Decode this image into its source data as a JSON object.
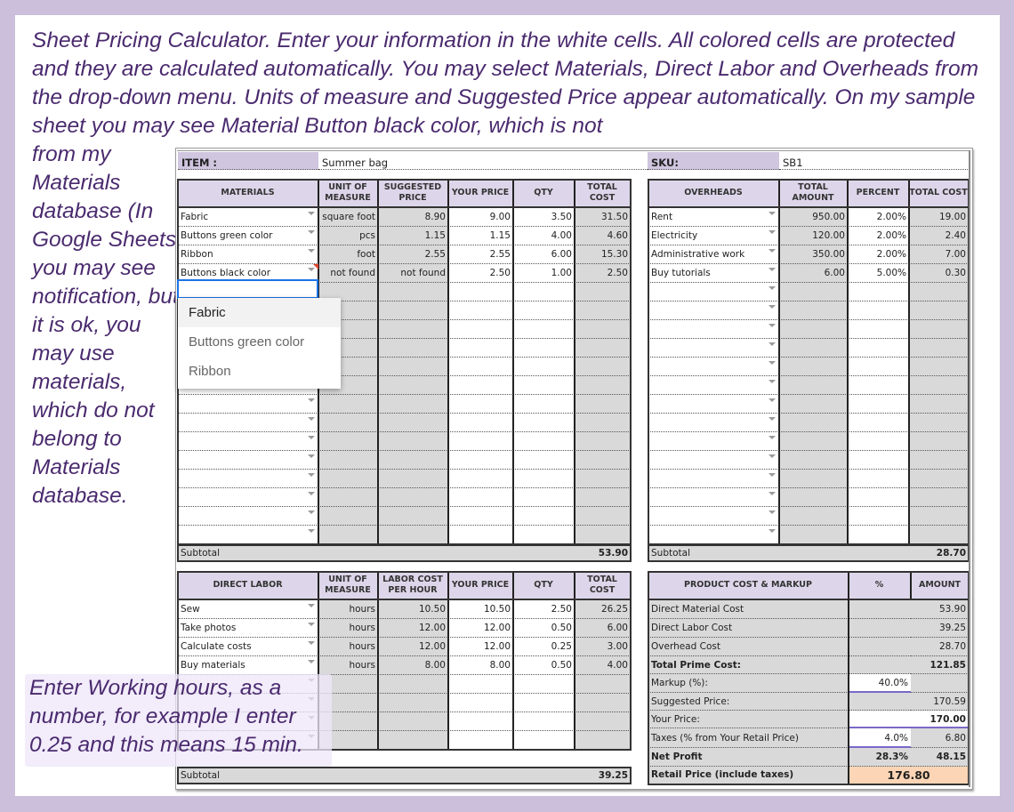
{
  "intro_text": "Sheet Pricing Calculator. Enter your information in the white cells. All colored cells are protected and they are calculated automatically. You may select Materials, Direct Labor and Overheads from the drop-down menu. Units of measure and Suggested Price appear automatically. On my sample sheet you may see Material Button black color, which is not",
  "side_text": "from my Materials database (In Google Sheets you may see notification, but it is ok, you may use materials, which do not belong to Materials database.",
  "note_text": "Enter Working hours, as a number, for example I enter 0.25 and this means 15 min.",
  "colors": {
    "background": "#cbbfdc",
    "header_fill": "#ddd6ea",
    "protected_fill": "#d9d9d9",
    "text_purple": "#4a2a6e",
    "retail_fill": "#fbd5b5",
    "selection_blue": "#1a73e8"
  },
  "item": {
    "label": "ITEM :",
    "value": "Summer bag"
  },
  "sku": {
    "label": "SKU:",
    "value": "SB1"
  },
  "materials": {
    "headers": [
      "MATERIALS",
      "UNIT OF MEASURE",
      "SUGGESTED PRICE",
      "YOUR PRICE",
      "QTY",
      "TOTAL COST"
    ],
    "rows": [
      {
        "name": "Fabric",
        "unit": "square foot",
        "suggested": "8.90",
        "price": "9.00",
        "qty": "3.50",
        "total": "31.50"
      },
      {
        "name": "Buttons green color",
        "unit": "pcs",
        "suggested": "1.15",
        "price": "1.15",
        "qty": "4.00",
        "total": "4.60"
      },
      {
        "name": "Ribbon",
        "unit": "foot",
        "suggested": "2.55",
        "price": "2.55",
        "qty": "6.00",
        "total": "15.30"
      },
      {
        "name": "Buttons black color",
        "unit": "not found",
        "suggested": "not found",
        "price": "2.50",
        "qty": "1.00",
        "total": "2.50"
      }
    ],
    "empty_rows": 14,
    "subtotal_label": "Subtotal",
    "subtotal": "53.90"
  },
  "dropdown": {
    "options": [
      "Fabric",
      "Buttons green color",
      "Ribbon"
    ],
    "highlighted": "Fabric"
  },
  "overheads": {
    "headers": [
      "OVERHEADS",
      "TOTAL AMOUNT",
      "PERCENT",
      "TOTAL COST"
    ],
    "rows": [
      {
        "name": "Rent",
        "amount": "950.00",
        "percent": "2.00%",
        "total": "19.00"
      },
      {
        "name": "Electricity",
        "amount": "120.00",
        "percent": "2.00%",
        "total": "2.40"
      },
      {
        "name": "Administrative work",
        "amount": "350.00",
        "percent": "2.00%",
        "total": "7.00"
      },
      {
        "name": "Buy tutorials",
        "amount": "6.00",
        "percent": "5.00%",
        "total": "0.30"
      }
    ],
    "empty_rows": 14,
    "subtotal_label": "Subtotal",
    "subtotal": "28.70"
  },
  "labor": {
    "headers": [
      "DIRECT LABOR",
      "UNIT OF MEASURE",
      "LABOR COST PER HOUR",
      "YOUR PRICE",
      "QTY",
      "TOTAL COST"
    ],
    "rows": [
      {
        "name": "Sew",
        "unit": "hours",
        "rate": "10.50",
        "price": "10.50",
        "qty": "2.50",
        "total": "26.25"
      },
      {
        "name": "Take photos",
        "unit": "hours",
        "rate": "12.00",
        "price": "12.00",
        "qty": "0.50",
        "total": "6.00"
      },
      {
        "name": "Calculate costs",
        "unit": "hours",
        "rate": "12.00",
        "price": "12.00",
        "qty": "0.25",
        "total": "3.00"
      },
      {
        "name": "Buy materials",
        "unit": "hours",
        "rate": "8.00",
        "price": "8.00",
        "qty": "0.50",
        "total": "4.00"
      }
    ],
    "empty_rows": 4,
    "subtotal_label": "Subtotal",
    "subtotal": "39.25"
  },
  "product_cost": {
    "headers": [
      "PRODUCT COST & MARKUP",
      "%",
      "AMOUNT"
    ],
    "rows": [
      {
        "label": "Direct Material Cost",
        "pct": "",
        "amount": "53.90",
        "bold": false
      },
      {
        "label": "Direct Labor Cost",
        "pct": "",
        "amount": "39.25",
        "bold": false
      },
      {
        "label": "Overhead Cost",
        "pct": "",
        "amount": "28.70",
        "bold": false
      },
      {
        "label": "Total Prime Cost:",
        "pct": "",
        "amount": "121.85",
        "bold": true
      },
      {
        "label": "Markup (%):",
        "pct": "40.0%",
        "amount": "",
        "bold": false
      },
      {
        "label": "Suggested Price:",
        "pct": "",
        "amount": "170.59",
        "bold": false
      },
      {
        "label": "Your Price:",
        "pct": "",
        "amount": "170.00",
        "bold": false
      },
      {
        "label": "Taxes (% from Your Retail Price)",
        "pct": "4.0%",
        "amount": "6.80",
        "bold": false
      },
      {
        "label": "Net Profit",
        "pct": "28.3%",
        "amount": "48.15",
        "bold": true
      }
    ],
    "retail_label": "Retail Price (include taxes)",
    "retail_value": "176.80"
  }
}
